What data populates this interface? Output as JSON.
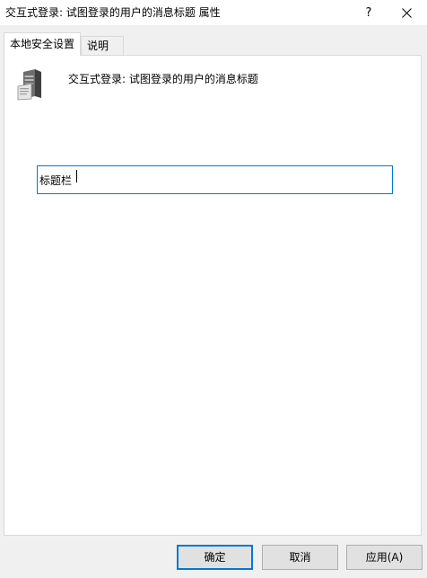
{
  "window": {
    "title": "交互式登录: 试图登录的用户的消息标题 属性",
    "help_label": "?",
    "close_icon": "close-icon"
  },
  "tabs": [
    {
      "label": "本地安全设置",
      "active": true
    },
    {
      "label": "说明",
      "active": false
    }
  ],
  "panel": {
    "policy_icon": "server-policy-icon",
    "policy_title": "交互式登录: 试图登录的用户的消息标题",
    "input_value": "标题栏"
  },
  "buttons": {
    "ok": "确定",
    "cancel": "取消",
    "apply": "应用(A)"
  },
  "colors": {
    "focus_border": "#0078d7",
    "window_bg": "#f0f0f0",
    "panel_bg": "#ffffff"
  }
}
